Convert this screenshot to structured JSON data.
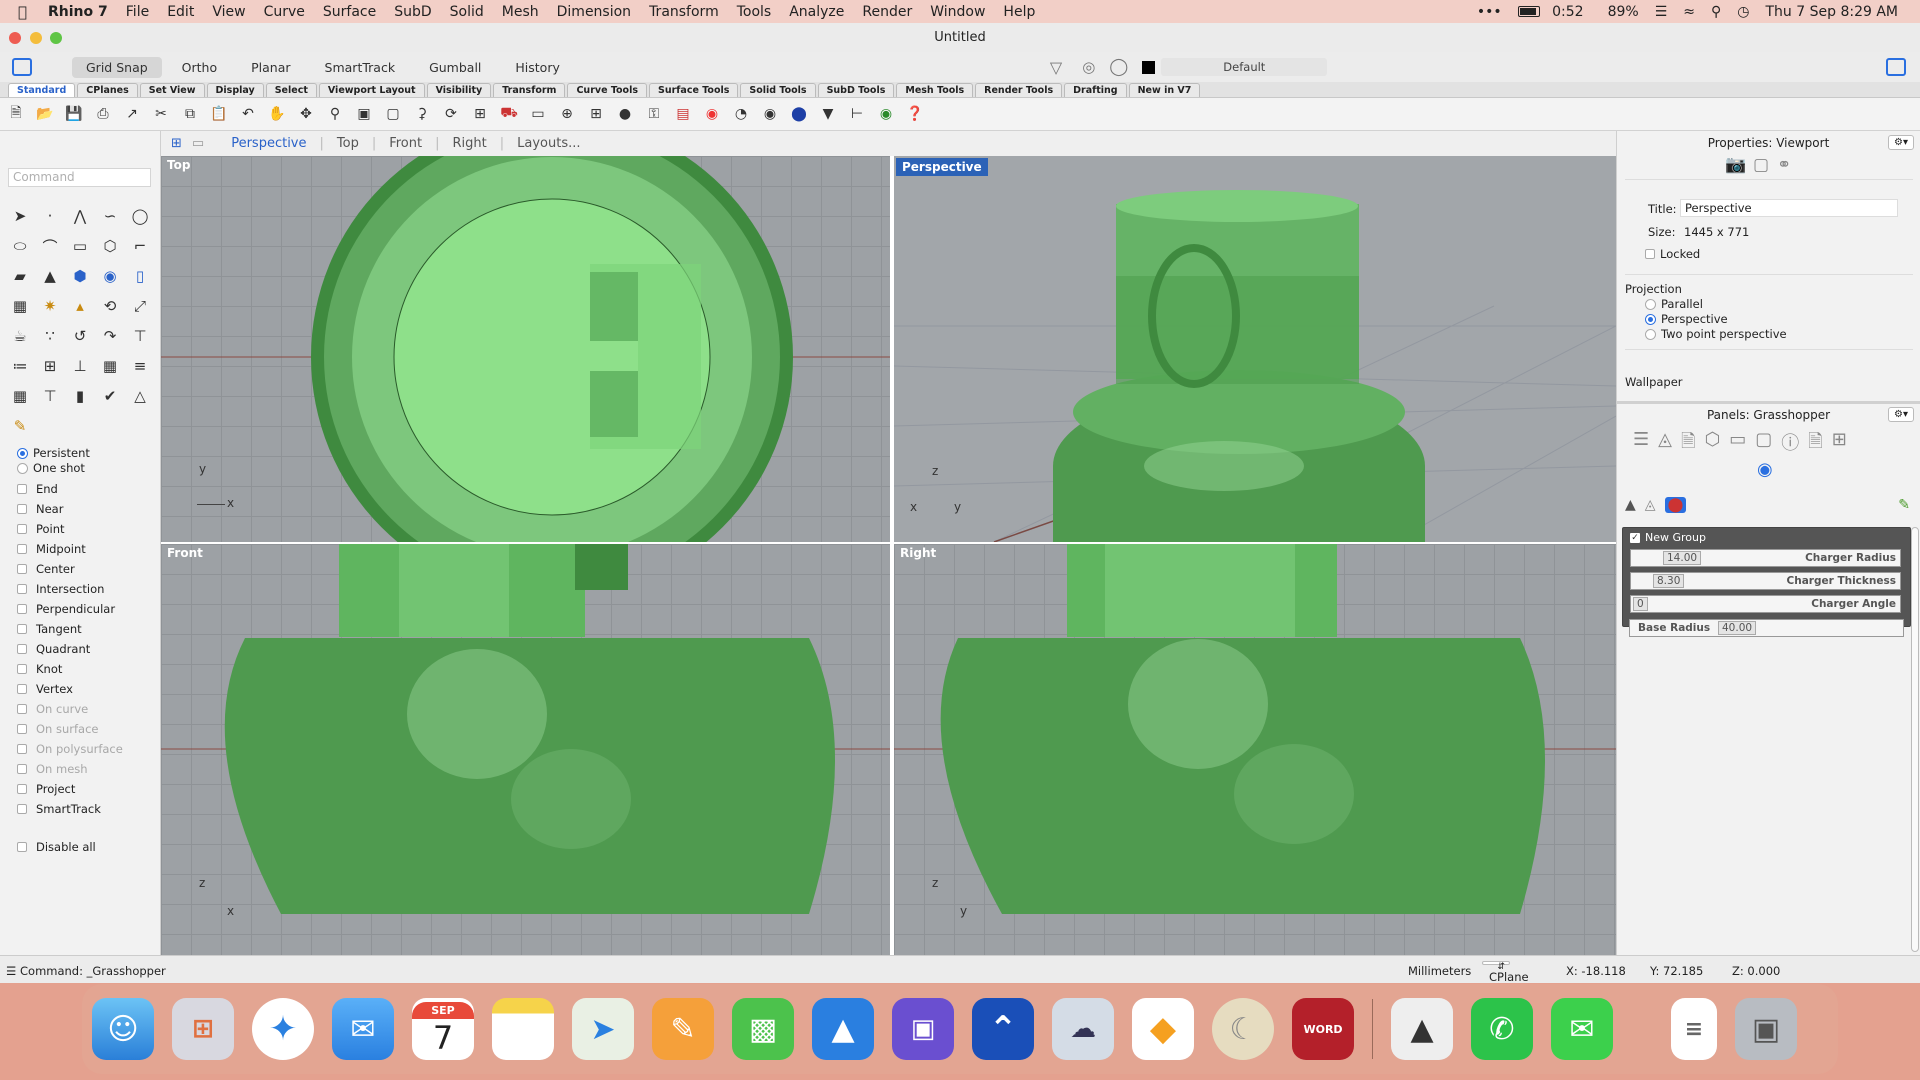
{
  "menubar": {
    "app": "Rhino 7",
    "items": [
      "File",
      "Edit",
      "View",
      "Curve",
      "Surface",
      "SubD",
      "Solid",
      "Mesh",
      "Dimension",
      "Transform",
      "Tools",
      "Analyze",
      "Render",
      "Window",
      "Help"
    ],
    "time_counter": "0:52",
    "battery": "89%",
    "datetime": "Thu 7 Sep  8:29 AM"
  },
  "window": {
    "title": "Untitled"
  },
  "toolbar": {
    "buttons": [
      "Grid Snap",
      "Ortho",
      "Planar",
      "SmartTrack",
      "Gumball",
      "History"
    ],
    "layer": "Default"
  },
  "tabs": [
    "Standard",
    "CPlanes",
    "Set View",
    "Display",
    "Select",
    "Viewport Layout",
    "Visibility",
    "Transform",
    "Curve Tools",
    "Surface Tools",
    "Solid Tools",
    "SubD Tools",
    "Mesh Tools",
    "Render Tools",
    "Drafting",
    "New in V7"
  ],
  "command": {
    "placeholder": "Command",
    "prompt": "Command: _Grasshopper"
  },
  "osnap": {
    "persistent": "Persistent",
    "one_shot": "One shot",
    "items": [
      "End",
      "Near",
      "Point",
      "Midpoint",
      "Center",
      "Intersection",
      "Perpendicular",
      "Tangent",
      "Quadrant",
      "Knot",
      "Vertex"
    ],
    "disabled_items": [
      "On curve",
      "On surface",
      "On polysurface",
      "On mesh"
    ],
    "extra": [
      "Project",
      "SmartTrack"
    ],
    "disable_all": "Disable all"
  },
  "viewport_tabs": [
    "Perspective",
    "Top",
    "Front",
    "Right",
    "Layouts..."
  ],
  "viewports": {
    "top": {
      "label": "Top",
      "ax1": "y",
      "ax2": "x"
    },
    "perspective": {
      "label": "Perspective",
      "ax1": "z",
      "ax2": "x",
      "ax3": "y"
    },
    "front": {
      "label": "Front",
      "ax1": "z",
      "ax2": "x"
    },
    "right": {
      "label": "Right",
      "ax1": "z",
      "ax2": "y"
    }
  },
  "properties": {
    "title": "Properties: Viewport",
    "title_label": "Title:",
    "title_value": "Perspective",
    "size_label": "Size:",
    "size_value": "1445 x 771",
    "locked": "Locked",
    "projection": "Projection",
    "parallel": "Parallel",
    "perspective": "Perspective",
    "two_point": "Two point perspective",
    "wallpaper": "Wallpaper"
  },
  "grasshopper": {
    "title": "Panels: Grasshopper",
    "group": "New Group",
    "sliders": [
      {
        "name": "Charger Radius",
        "value": "14.00"
      },
      {
        "name": "Charger Thickness",
        "value": "8.30"
      },
      {
        "name": "Charger Angle",
        "value": "0"
      },
      {
        "name": "Base Radius",
        "value": "40.00"
      }
    ]
  },
  "status": {
    "units": "Millimeters",
    "cplane": "CPlane",
    "x": "X: -18.118",
    "y": "Y: 72.185",
    "z": "Z: 0.000"
  },
  "dock": {
    "calendar_month": "SEP",
    "calendar_day": "7",
    "word": "WORD"
  },
  "colors": {
    "accent": "#2a62c9",
    "model_green": "#5fbf5f",
    "viewport_bg": "#9da1a5"
  }
}
